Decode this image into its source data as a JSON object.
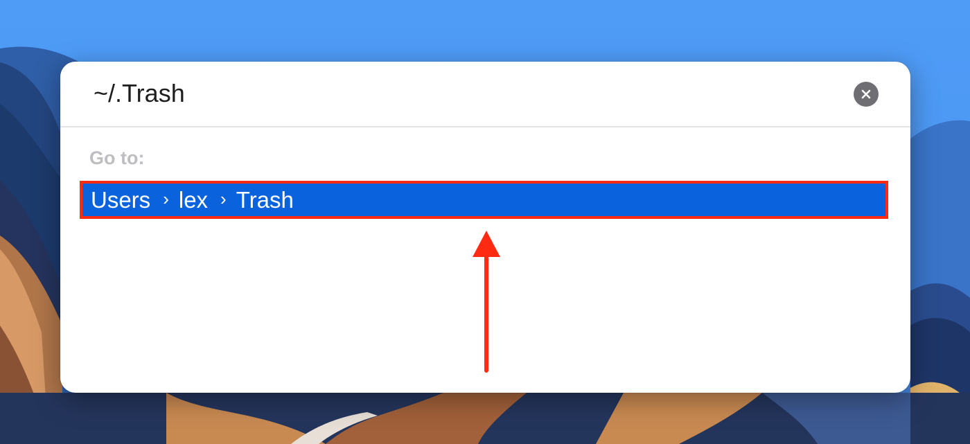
{
  "goto_dialog": {
    "path_value": "~/.Trash",
    "section_label": "Go to:",
    "result": {
      "crumbs": [
        "Users",
        "lex",
        "Trash"
      ],
      "separator": "›"
    },
    "clear_icon": "close-circle-icon"
  },
  "colors": {
    "selection": "#0a63dd",
    "annotation": "#ff2a12",
    "desktop_sky": "#4f9cf7"
  }
}
